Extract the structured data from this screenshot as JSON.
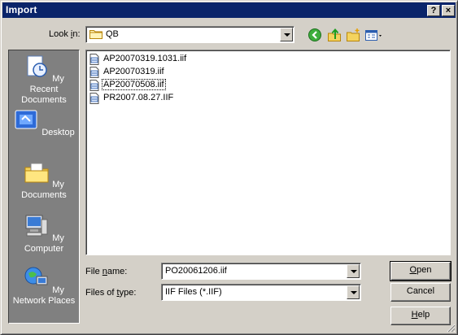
{
  "window": {
    "title": "Import",
    "help_label": "?",
    "close_label": "×"
  },
  "look_in": {
    "label_pre": "Look ",
    "label_accel": "i",
    "label_post": "n:",
    "value": "QB"
  },
  "toolbar": {
    "icons": [
      "back-icon",
      "up-folder-icon",
      "new-folder-icon",
      "view-menu-icon"
    ]
  },
  "places": [
    {
      "label": "My Recent Documents",
      "icon": "recent-documents-icon"
    },
    {
      "label": "Desktop",
      "icon": "desktop-icon"
    },
    {
      "label": "My Documents",
      "icon": "my-documents-icon"
    },
    {
      "label": "My Computer",
      "icon": "my-computer-icon"
    },
    {
      "label": "My Network Places",
      "icon": "network-places-icon"
    }
  ],
  "files": [
    {
      "name": "AP20070319.1031.iif",
      "focused": false
    },
    {
      "name": "AP20070319.iif",
      "focused": false
    },
    {
      "name": "AP20070508.iif",
      "focused": true
    },
    {
      "name": "PR2007.08.27.IIF",
      "focused": false
    }
  ],
  "file_name": {
    "label_pre": "File ",
    "label_accel": "n",
    "label_post": "ame:",
    "value": "PO20061206.iif"
  },
  "file_type": {
    "label_pre": "Files of ",
    "label_accel": "t",
    "label_post": "ype:",
    "value": "IIF Files (*.IIF)"
  },
  "buttons": {
    "open_accel": "O",
    "open_rest": "pen",
    "cancel": "Cancel",
    "help_accel": "H",
    "help_rest": "elp"
  }
}
